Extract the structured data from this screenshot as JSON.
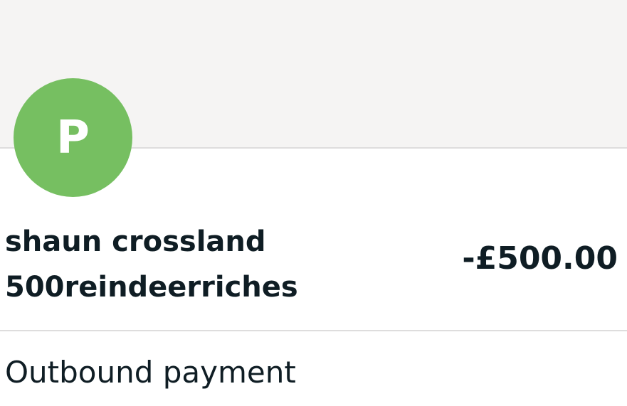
{
  "avatar": {
    "initial": "P",
    "color": "#76bf61"
  },
  "transaction": {
    "payee_line1": "shaun crossland",
    "payee_line2": "500reindeerriches",
    "amount": "-£500.00",
    "type": "Outbound payment"
  },
  "colors": {
    "header_background": "#f5f4f3",
    "divider": "#dedddd",
    "text": "#0f1d24"
  }
}
